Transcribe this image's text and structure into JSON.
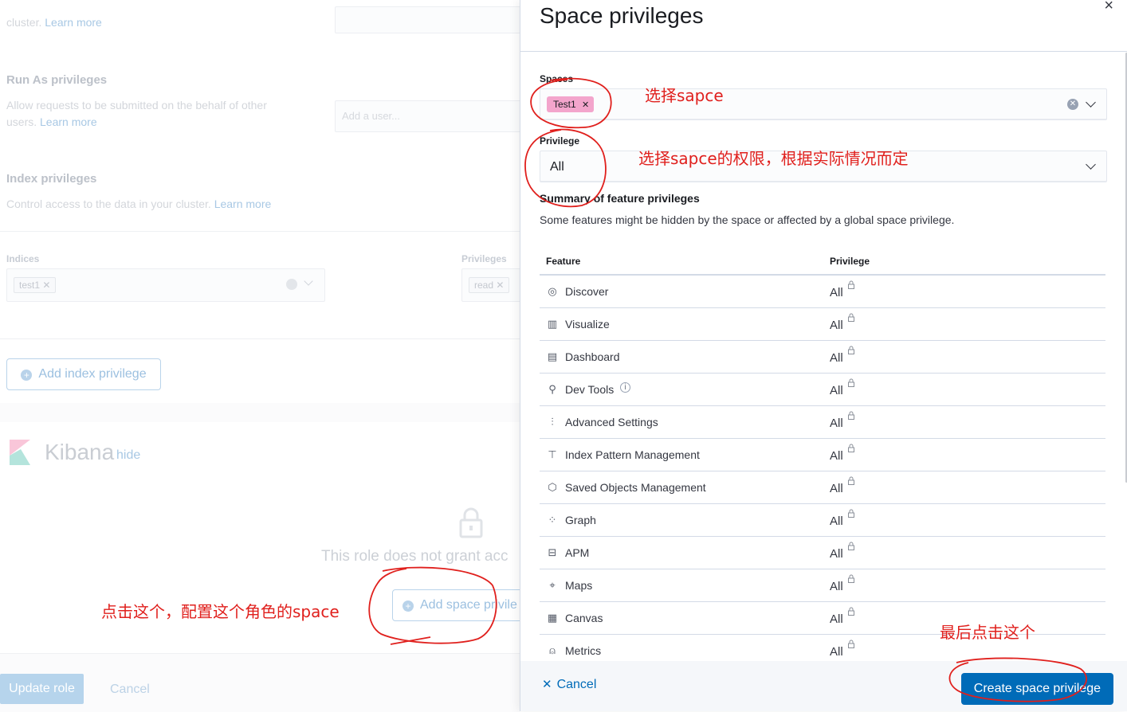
{
  "background": {
    "top_text": "cluster.",
    "top_link": "Learn more",
    "run_as": {
      "title": "Run As privileges",
      "desc_line1": "Allow requests to be submitted on the behalf of other",
      "desc_line2": "users.",
      "link": "Learn more",
      "placeholder": "Add a user..."
    },
    "index": {
      "title": "Index privileges",
      "desc": "Control access to the data in your cluster.",
      "link": "Learn more",
      "indices_label": "Indices",
      "indices_chip": "test1",
      "privileges_label": "Privileges",
      "privileges_chip": "read",
      "add_button": "Add index privilege"
    },
    "kibana": {
      "title": "Kibana",
      "hide_link": "hide",
      "empty_text": "This role does not grant acc",
      "add_space_button": "Add space privile"
    },
    "footer": {
      "update": "Update role",
      "cancel": "Cancel"
    }
  },
  "flyout": {
    "title": "Space privileges",
    "close_glyph": "×",
    "spaces_label": "Spaces",
    "space_chip": "Test1",
    "privilege_label": "Privilege",
    "privilege_value": "All",
    "summary_title": "Summary of feature privileges",
    "summary_desc": "Some features might be hidden by the space or affected by a global space privilege.",
    "table_headers": {
      "feature": "Feature",
      "privilege": "Privilege"
    },
    "rows": [
      {
        "feature": "Discover",
        "privilege": "All",
        "icon": "discover-icon"
      },
      {
        "feature": "Visualize",
        "privilege": "All",
        "icon": "visualize-icon"
      },
      {
        "feature": "Dashboard",
        "privilege": "All",
        "icon": "dashboard-icon"
      },
      {
        "feature": "Dev Tools",
        "privilege": "All",
        "icon": "dev-tools-icon"
      },
      {
        "feature": "Advanced Settings",
        "privilege": "All",
        "icon": "advanced-settings-icon"
      },
      {
        "feature": "Index Pattern Management",
        "privilege": "All",
        "icon": "index-pattern-icon"
      },
      {
        "feature": "Saved Objects Management",
        "privilege": "All",
        "icon": "saved-objects-icon"
      },
      {
        "feature": "Graph",
        "privilege": "All",
        "icon": "graph-icon"
      },
      {
        "feature": "APM",
        "privilege": "All",
        "icon": "apm-icon"
      },
      {
        "feature": "Maps",
        "privilege": "All",
        "icon": "maps-icon"
      },
      {
        "feature": "Canvas",
        "privilege": "All",
        "icon": "canvas-icon"
      },
      {
        "feature": "Metrics",
        "privilege": "All",
        "icon": "metrics-icon"
      }
    ],
    "cancel": "Cancel",
    "create": "Create space privilege"
  },
  "annotations": {
    "select_space": "选择sapce",
    "select_privilege": "选择sapce的权限，根据实际情况而定",
    "click_add": "点击这个，配置这个角色的space",
    "finally_click": "最后点击这个"
  },
  "colors": {
    "primary": "#006bb8",
    "chip_pink": "#f3a5cc",
    "annotation_red": "#e0201d"
  }
}
